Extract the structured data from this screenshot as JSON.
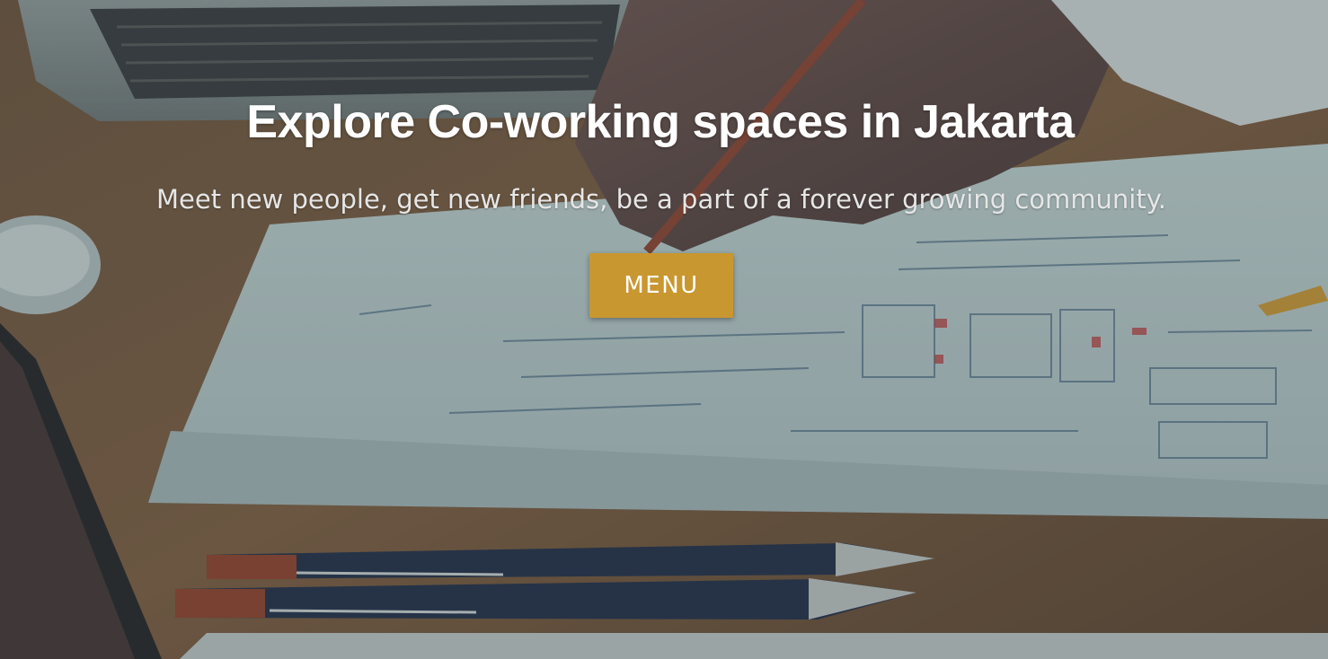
{
  "hero": {
    "title": "Explore Co-working spaces in Jakarta",
    "subtitle": "Meet new people, get new friends, be a part of a forever growing community.",
    "menu_button_label": "MENU"
  },
  "colors": {
    "button_bg": "#c9972f",
    "title_text": "#ffffff",
    "subtitle_text": "#e6e6e6"
  },
  "background": {
    "depicts": [
      "laptop",
      "hand-holding-pen",
      "sketched-wireframe-papers",
      "pens",
      "wooden-desk",
      "mouse"
    ]
  }
}
